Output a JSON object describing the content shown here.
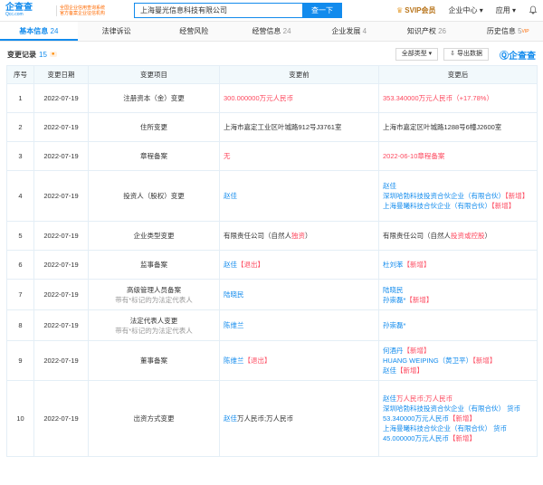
{
  "header": {
    "logo": "企查查",
    "logo_sub": "Qcc.com",
    "cert_line1": "全国企业信用查询系统",
    "cert_line2": "官方备案企业征信机构",
    "search_value": "上海曼光信息科技有限公司",
    "search_button": "查一下",
    "svip": "SVIP会员",
    "enterprise_center": "企业中心",
    "apps": "应用"
  },
  "tabs": [
    {
      "label": "基本信息",
      "count": "24"
    },
    {
      "label": "法律诉讼",
      "count": ""
    },
    {
      "label": "经营风险",
      "count": ""
    },
    {
      "label": "经营信息",
      "count": "24"
    },
    {
      "label": "企业发展",
      "count": "4"
    },
    {
      "label": "知识产权",
      "count": "26"
    },
    {
      "label": "历史信息",
      "count": "5",
      "sup": "VIP"
    }
  ],
  "section": {
    "title": "变更记录",
    "count": "15",
    "filter": "全部类型",
    "export": "导出数据",
    "brand": "企查查"
  },
  "table": {
    "headers": [
      "序号",
      "变更日期",
      "变更项目",
      "变更前",
      "变更后"
    ],
    "rows": [
      {
        "no": "1",
        "date": "2022-07-19",
        "item": "注册资本（金）变更",
        "before": "300.000000万元人民币",
        "after": "353.340000万元人民币（+17.78%）"
      },
      {
        "no": "2",
        "date": "2022-07-19",
        "item": "住所变更",
        "before": "上海市嘉定工业区叶城路912号J3761室",
        "after": "上海市嘉定区叶城路1288号6幢J2600室"
      },
      {
        "no": "3",
        "date": "2022-07-19",
        "item": "章程备案",
        "before": "无",
        "after": "2022-06-10章程备案"
      },
      {
        "no": "4",
        "date": "2022-07-19",
        "item": "投资人（股权）变更",
        "before": "赵佳",
        "after1": "赵佳",
        "after2": "深圳哈勃科技投资合伙企业（有限合伙）",
        "after2_tag": "【新增】",
        "after3": "上海曼曦科技合伙企业（有限合伙）",
        "after3_tag": "【新增】"
      },
      {
        "no": "5",
        "date": "2022-07-19",
        "item": "企业类型变更",
        "before_a": "有限责任公司（自然人",
        "before_b": "独资",
        "before_c": "）",
        "after_a": "有限责任公司（自然人",
        "after_b": "投资或控股",
        "after_c": "）"
      },
      {
        "no": "6",
        "date": "2022-07-19",
        "item": "监事备案",
        "before": "赵佳",
        "before_tag": "【退出】",
        "after": "杜刘苯",
        "after_tag": "【新增】"
      },
      {
        "no": "7",
        "date": "2022-07-19",
        "item": "高级管理人员备案",
        "item_note": "带有*标记的为法定代表人",
        "before": "陆晓民",
        "after1": "陆晓民",
        "after2": "孙崇磊*",
        "after2_tag": "【新增】"
      },
      {
        "no": "8",
        "date": "2022-07-19",
        "item": "法定代表人变更",
        "item_note": "带有*标记的为法定代表人",
        "before": "陈维兰",
        "after": "孙崇磊*"
      },
      {
        "no": "9",
        "date": "2022-07-19",
        "item": "董事备案",
        "before": "陈维兰",
        "before_tag": "【退出】",
        "after1": "何酒丹",
        "after1_tag": "【新增】",
        "after2": "HUANG WEIPING（黄卫平）",
        "after2_tag": "【新增】",
        "after3": "赵佳",
        "after3_tag": "【新增】"
      },
      {
        "no": "10",
        "date": "2022-07-19",
        "item": "出资方式变更",
        "before_a": "赵佳",
        "before_b": "万人民币;万人民币",
        "after1_a": "赵佳",
        "after1_b": "万人民币;万人民币",
        "after2": "深圳哈勃科技投资合伙企业（有限合伙）  货币53.340000万元人民币",
        "after2_tag": "【新增】",
        "after3": "上海曼曦科技合伙企业（有限合伙）  货币45.000000万元人民币",
        "after3_tag": "【新增】"
      }
    ]
  }
}
